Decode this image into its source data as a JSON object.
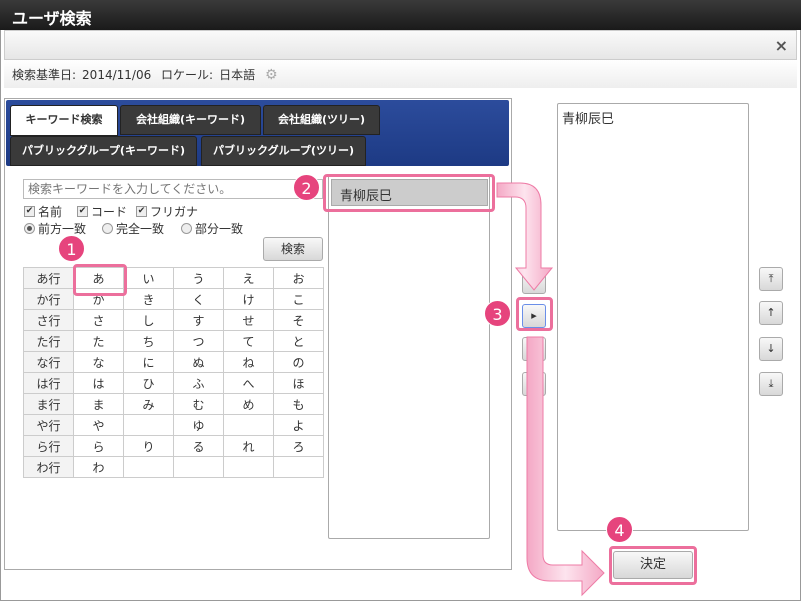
{
  "title": "ユーザ検索",
  "close_icon": "×",
  "info": {
    "date_label": "検索基準日:",
    "date": "2014/11/06",
    "locale_label": "ロケール:",
    "locale": "日本語"
  },
  "tabs": [
    "キーワード検索",
    "会社組織(キーワード)",
    "会社組織(ツリー)",
    "パブリックグループ(キーワード)",
    "パブリックグループ(ツリー)"
  ],
  "search": {
    "placeholder": "検索キーワードを入力してください。",
    "checks": [
      "名前",
      "コード",
      "フリガナ"
    ],
    "match": [
      "前方一致",
      "完全一致",
      "部分一致"
    ],
    "button": "検索"
  },
  "kana": [
    [
      "あ行",
      "あ",
      "い",
      "う",
      "え",
      "お"
    ],
    [
      "か行",
      "か",
      "き",
      "く",
      "け",
      "こ"
    ],
    [
      "さ行",
      "さ",
      "し",
      "す",
      "せ",
      "そ"
    ],
    [
      "た行",
      "た",
      "ち",
      "つ",
      "て",
      "と"
    ],
    [
      "な行",
      "な",
      "に",
      "ぬ",
      "ね",
      "の"
    ],
    [
      "は行",
      "は",
      "ひ",
      "ふ",
      "へ",
      "ほ"
    ],
    [
      "ま行",
      "ま",
      "み",
      "む",
      "め",
      "も"
    ],
    [
      "や行",
      "や",
      "",
      "ゆ",
      "",
      "よ"
    ],
    [
      "ら行",
      "ら",
      "り",
      "る",
      "れ",
      "ろ"
    ],
    [
      "わ行",
      "わ",
      "",
      "",
      "",
      ""
    ]
  ],
  "results": [
    "青柳辰巳"
  ],
  "selected": [
    "青柳辰巳"
  ],
  "move_buttons": [
    "▸"
  ],
  "order_buttons": [
    "⤒",
    "↑",
    "↓",
    "⤓"
  ],
  "confirm": "決定",
  "badges": [
    "1",
    "2",
    "3",
    "4"
  ],
  "colors": {
    "accent": "#e6447d",
    "tabbar": "#1d3a84"
  }
}
